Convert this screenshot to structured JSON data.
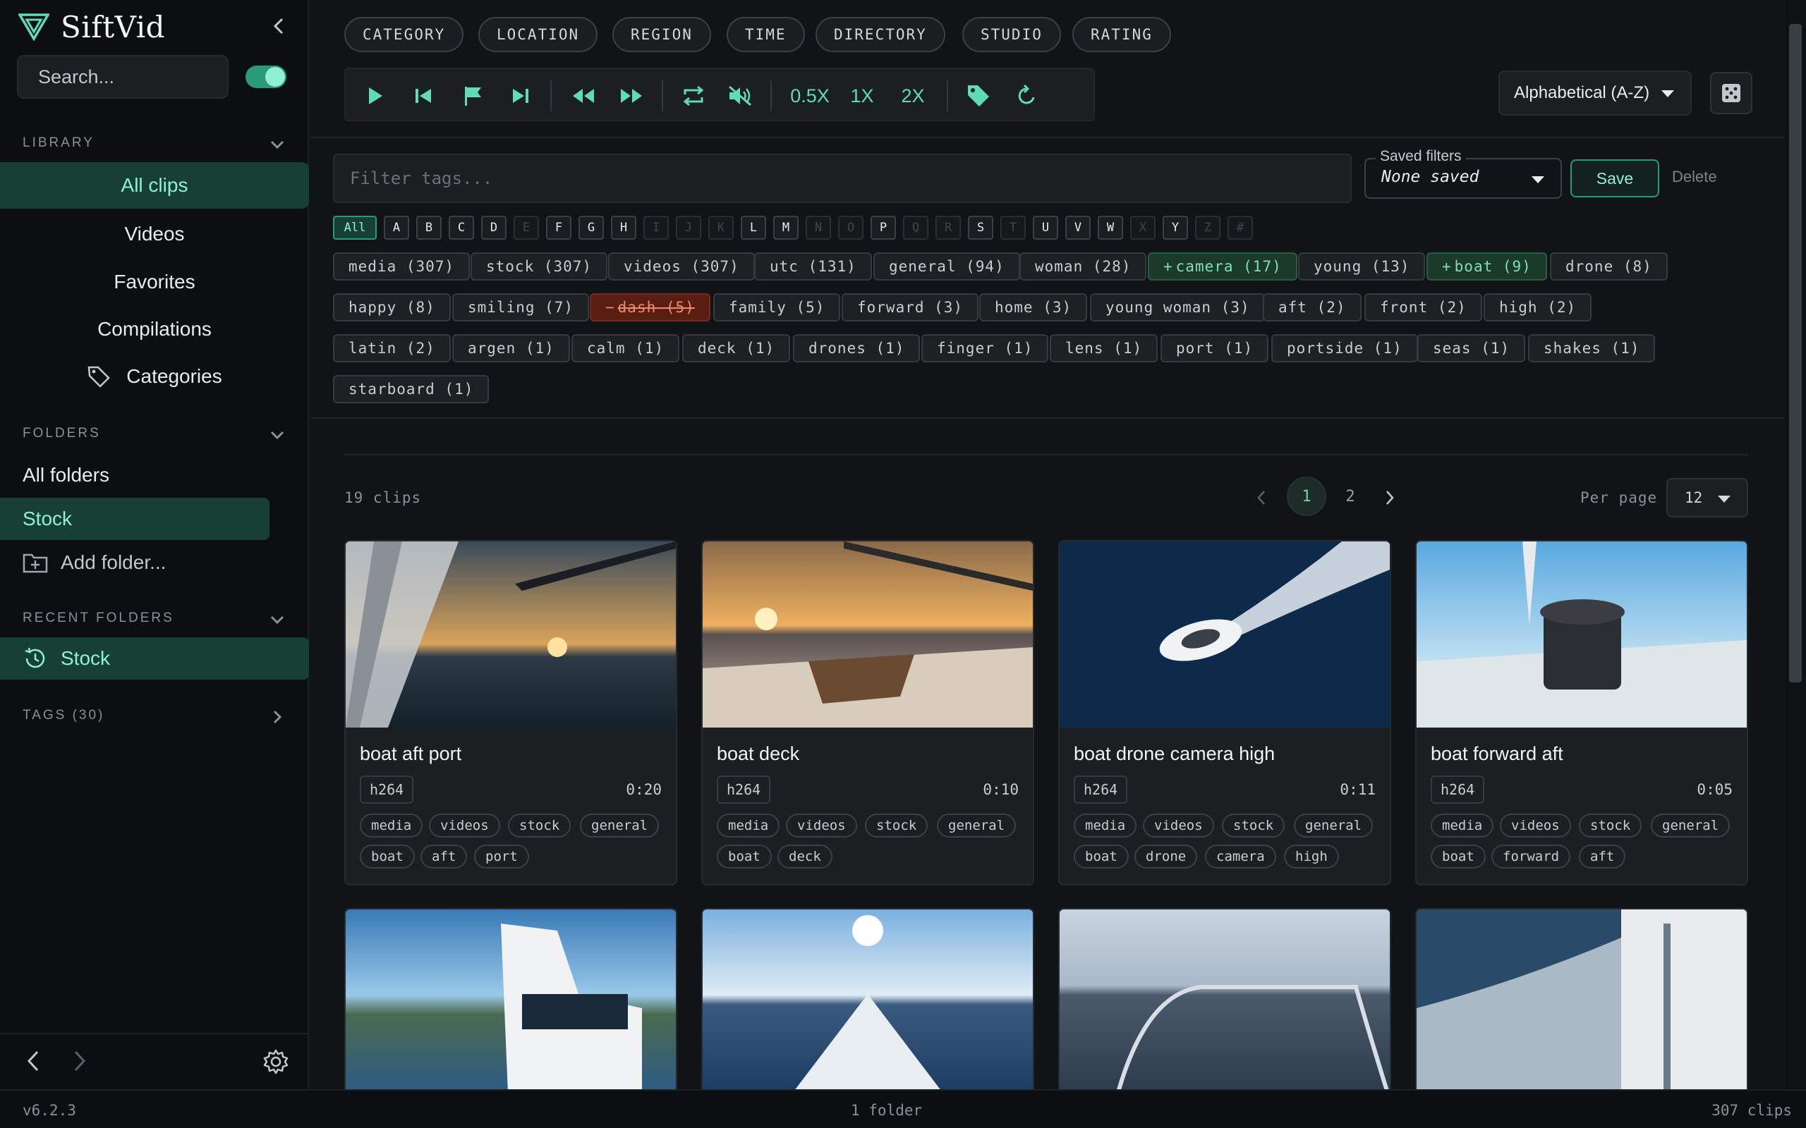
{
  "app": {
    "name": "SiftVid",
    "version": "v6.2.3"
  },
  "sidebar": {
    "search_placeholder": "Search...",
    "library_title": "LIBRARY",
    "library_items": [
      {
        "label": "All clips",
        "active": true
      },
      {
        "label": "Videos"
      },
      {
        "label": "Favorites"
      },
      {
        "label": "Compilations"
      },
      {
        "label": "Categories",
        "icon": "tag-icon"
      }
    ],
    "folders_title": "FOLDERS",
    "folders": [
      {
        "label": "All folders"
      },
      {
        "label": "Stock",
        "active": true
      },
      {
        "label": "Add folder...",
        "icon": "add-folder-icon"
      }
    ],
    "recent_title": "RECENT FOLDERS",
    "recent": [
      {
        "label": "Stock",
        "icon": "history-icon"
      }
    ],
    "tags_title": "TAGS (30)"
  },
  "categories": [
    "CATEGORY",
    "LOCATION",
    "REGION",
    "TIME",
    "DIRECTORY",
    "STUDIO",
    "RATING"
  ],
  "toolbar": {
    "speeds": [
      "0.5X",
      "1X",
      "2X"
    ]
  },
  "sort": {
    "selected": "Alphabetical (A-Z)"
  },
  "filter": {
    "placeholder": "Filter tags...",
    "saved_label": "Saved filters",
    "saved_value": "None saved",
    "save": "Save",
    "delete": "Delete"
  },
  "letters": [
    {
      "l": "All",
      "on": true,
      "sel": true
    },
    {
      "l": "A",
      "on": true
    },
    {
      "l": "B",
      "on": true
    },
    {
      "l": "C",
      "on": true
    },
    {
      "l": "D",
      "on": true
    },
    {
      "l": "E",
      "on": false
    },
    {
      "l": "F",
      "on": true
    },
    {
      "l": "G",
      "on": true
    },
    {
      "l": "H",
      "on": true
    },
    {
      "l": "I",
      "on": false
    },
    {
      "l": "J",
      "on": false
    },
    {
      "l": "K",
      "on": false
    },
    {
      "l": "L",
      "on": true
    },
    {
      "l": "M",
      "on": true
    },
    {
      "l": "N",
      "on": false
    },
    {
      "l": "O",
      "on": false
    },
    {
      "l": "P",
      "on": true
    },
    {
      "l": "Q",
      "on": false
    },
    {
      "l": "R",
      "on": false
    },
    {
      "l": "S",
      "on": true
    },
    {
      "l": "T",
      "on": false
    },
    {
      "l": "U",
      "on": true
    },
    {
      "l": "V",
      "on": true
    },
    {
      "l": "W",
      "on": true
    },
    {
      "l": "X",
      "on": false
    },
    {
      "l": "Y",
      "on": true
    },
    {
      "l": "Z",
      "on": false
    },
    {
      "l": "#",
      "on": false
    }
  ],
  "tags": [
    [
      {
        "t": "media (307)"
      },
      {
        "t": "stock (307)"
      },
      {
        "t": "videos (307)"
      },
      {
        "t": "utc (131)"
      },
      {
        "t": "general (94)"
      },
      {
        "t": "woman (28)"
      },
      {
        "t": "camera (17)",
        "s": "inc"
      },
      {
        "t": "young (13)"
      },
      {
        "t": "boat (9)",
        "s": "inc"
      },
      {
        "t": "drone (8)"
      }
    ],
    [
      {
        "t": "happy (8)"
      },
      {
        "t": "smiling (7)"
      },
      {
        "t": "dash (5)",
        "s": "exc"
      },
      {
        "t": "family (5)"
      },
      {
        "t": "forward (3)"
      },
      {
        "t": "home (3)"
      },
      {
        "t": "young woman (3)"
      },
      {
        "t": "aft (2)"
      },
      {
        "t": "front (2)"
      },
      {
        "t": "high (2)"
      }
    ],
    [
      {
        "t": "latin (2)"
      },
      {
        "t": "argen (1)"
      },
      {
        "t": "calm (1)"
      },
      {
        "t": "deck (1)"
      },
      {
        "t": "drones (1)"
      },
      {
        "t": "finger (1)"
      },
      {
        "t": "lens (1)"
      },
      {
        "t": "port (1)"
      },
      {
        "t": "portside (1)"
      },
      {
        "t": "seas (1)"
      },
      {
        "t": "shakes (1)"
      }
    ],
    [
      {
        "t": "starboard (1)"
      }
    ]
  ],
  "results": {
    "count": "19 clips",
    "pages": [
      "1",
      "2"
    ],
    "current_page": "1",
    "per_page_label": "Per page",
    "per_page": "12"
  },
  "clips": [
    {
      "title": "boat aft port",
      "codec": "h264",
      "duration": "0:20",
      "tags": [
        "media",
        "videos",
        "stock",
        "general",
        "boat",
        "aft",
        "port"
      ]
    },
    {
      "title": "boat deck",
      "codec": "h264",
      "duration": "0:10",
      "tags": [
        "media",
        "videos",
        "stock",
        "general",
        "boat",
        "deck"
      ]
    },
    {
      "title": "boat drone camera high",
      "codec": "h264",
      "duration": "0:11",
      "tags": [
        "media",
        "videos",
        "stock",
        "general",
        "boat",
        "drone",
        "camera",
        "high"
      ]
    },
    {
      "title": "boat forward aft",
      "codec": "h264",
      "duration": "0:05",
      "tags": [
        "media",
        "videos",
        "stock",
        "general",
        "boat",
        "forward",
        "aft"
      ]
    }
  ],
  "status": {
    "folders": "1 folder",
    "clips": "307 clips"
  },
  "colors": {
    "accent": "#5fdbb6",
    "accent_bg": "#173f36",
    "exclude": "#f08a6e",
    "background": "#111417"
  }
}
